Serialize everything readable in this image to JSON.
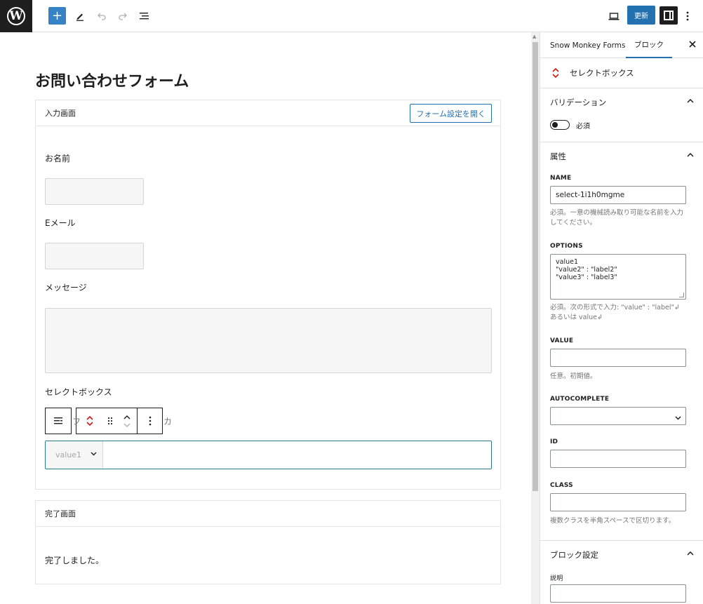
{
  "toolbar": {
    "logo_glyph": "W",
    "add_block_glyph": "+",
    "update_label": "更新"
  },
  "editor": {
    "page_title": "お問い合わせフォーム",
    "input_screen": {
      "header": "入力画面",
      "open_settings_label": "フォーム設定を開く",
      "fields": {
        "name_label": "お名前",
        "email_label": "Eメール",
        "message_label": "メッセージ",
        "select_label": "セレクトボックス"
      },
      "ghost_left": "フ",
      "ghost_right": "カ",
      "select_value": "value1"
    },
    "complete_screen": {
      "header": "完了画面",
      "message": "完了しました。"
    }
  },
  "sidebar": {
    "tabs": [
      "Snow Monkey Forms",
      "ブロック"
    ],
    "active_tab": "ブロック",
    "block_name": "セレクトボックス",
    "validation": {
      "title": "バリデーション",
      "required_label": "必須",
      "required_on": false
    },
    "attributes": {
      "title": "属性",
      "name_label": "NAME",
      "name_value": "select-1i1h0mgme",
      "name_help": "必須。一意の機械読み取り可能な名前を入力してください。",
      "options_label": "OPTIONS",
      "options_lines": [
        "value1",
        "\"value2\" : \"label2\"",
        "\"value3\" : \"label3\""
      ],
      "options_help": "必須。次の形式で入力: \"value\" : \"label\"↲ あるいは value↲",
      "value_label": "VALUE",
      "value_value": "",
      "value_help": "任意。初期値。",
      "autocomplete_label": "AUTOCOMPLETE",
      "id_label": "ID",
      "class_label": "CLASS",
      "class_help": "複数クラスを半角スペースで区切ります。"
    },
    "block_settings": {
      "title": "ブロック設定",
      "description_label": "説明"
    }
  },
  "colors": {
    "accent": "#2271b1",
    "plus_button": "#3582c4",
    "select_border": "#2a7b8a",
    "block_icon": "#cc1818"
  }
}
